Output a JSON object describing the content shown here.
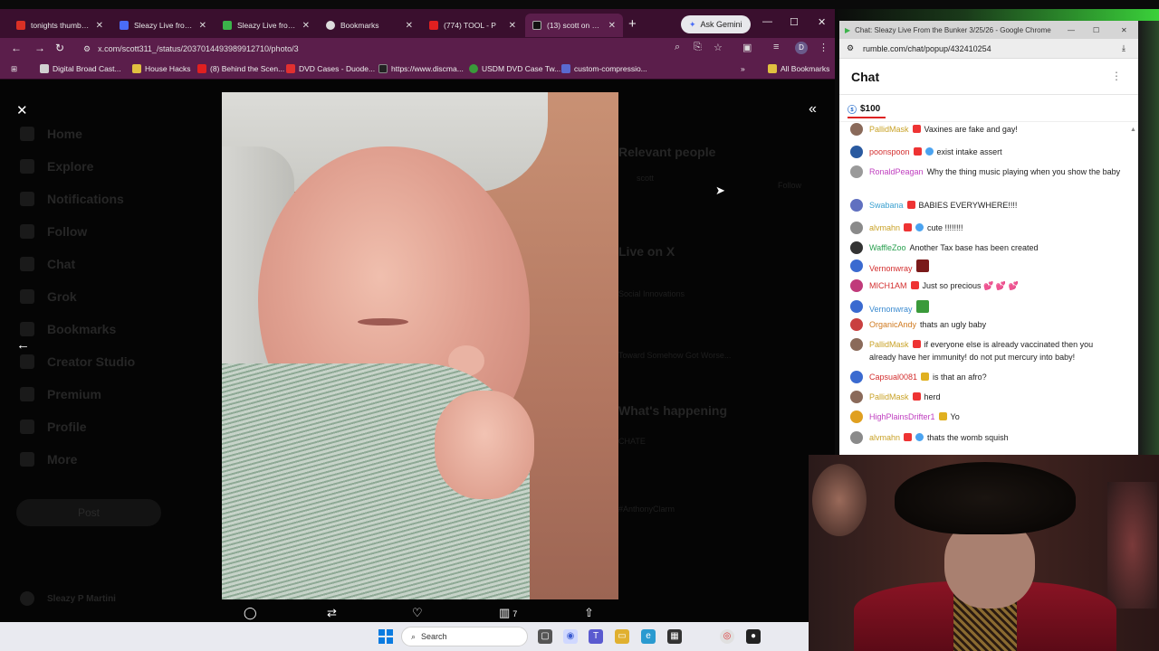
{
  "browser": {
    "tabs": [
      {
        "label": "tonights thumbs - |",
        "color": "#d93025"
      },
      {
        "label": "Sleazy Live from th",
        "color": "#4a6cf7"
      },
      {
        "label": "Sleazy Live from th",
        "color": "#3bb34a"
      },
      {
        "label": "Bookmarks",
        "color": "#dddddd"
      },
      {
        "label": "(774) TOOL - P",
        "color": "#e02020"
      },
      {
        "label": "(13) scott on X: \"h",
        "color": "#111111"
      }
    ],
    "ask_gemini": "Ask Gemini",
    "url": "x.com/scott311_/status/2037014493989912710/photo/3",
    "profile_initial": "D",
    "bookmarks": [
      "Digital Broad Cast...",
      "House Hacks",
      "(8) Behind the Scen...",
      "DVD Cases - Duode...",
      "https://www.discma...",
      "USDM DVD Case Tw...",
      "custom-compressio..."
    ],
    "all_bookmarks": "All Bookmarks",
    "more_bookmarks": "»"
  },
  "xpage": {
    "nav_items": [
      "Home",
      "Explore",
      "Notifications",
      "Follow",
      "Chat",
      "Grok",
      "Bookmarks",
      "Creator Studio",
      "Premium",
      "Profile",
      "More"
    ],
    "post_button": "Post",
    "right_headings": [
      "Relevant people",
      "Live on X",
      "What's happening"
    ],
    "right_texts": [
      "scott",
      "Follow",
      "Social Innovations",
      "Toward Somehow Got Worse...",
      "CHATE",
      "#AnthonyClarm"
    ],
    "bottom_user": "Sleazy P Martini",
    "actions": {
      "views": "7"
    }
  },
  "icons": {
    "close": "✕",
    "back": "←",
    "collapse": "«",
    "reply": "💬",
    "repost": "⇄",
    "like": "♡",
    "views": "📊",
    "share": "⇧"
  },
  "taskbar": {
    "search_label": "Search"
  },
  "chat_window": {
    "title_bar": "Chat: Sleazy Live From the Bunker 3/25/26 - Google Chrome",
    "url": "rumble.com/chat/popup/432410254",
    "heading": "Chat",
    "rant_amount": "$100",
    "messages": [
      {
        "user": "PallidMask",
        "text": "Vaxines are fake and gay!",
        "color": "#c9a227",
        "avatar": "#8a6a5a",
        "badge": "#e33"
      },
      {
        "user": "poonspoon",
        "text": "exist intake assert",
        "color": "#d32f2f",
        "avatar": "#2a5aa0",
        "badge": "#e33",
        "badge2": "#4aa3f0"
      },
      {
        "user": "RonaldPeagan",
        "text": "Why the thing music playing when you show the baby",
        "color": "#c040c0",
        "avatar": "#9a9a9a"
      },
      {
        "user": "Swabana",
        "text": "BABIES EVERYWHERE!!!!",
        "color": "#3aa0d0",
        "avatar": "#6070c0",
        "badge": "#e33"
      },
      {
        "user": "alvmahn",
        "text": "cute !!!!!!!!",
        "color": "#c9a227",
        "avatar": "#8a8a8a",
        "badge": "#e33",
        "badge2": "#4aa3f0"
      },
      {
        "user": "WaffleZoo",
        "text": "Another Tax base has been created",
        "color": "#2aa050",
        "avatar": "#333333"
      },
      {
        "user": "Vernonwray",
        "text": "",
        "color": "#d32f2f",
        "avatar": "#3a6ad0"
      },
      {
        "user": "MICH1AM",
        "text": "Just so precious 💕 💕 💕",
        "color": "#d32f2f",
        "avatar": "#c03a7a",
        "badge": "#e33"
      },
      {
        "user": "Vernonwray",
        "text": "",
        "color": "#3a8ad0",
        "avatar": "#3a6ad0"
      },
      {
        "user": "OrganicAndy",
        "text": "thats an ugly baby",
        "color": "#d07a20",
        "avatar": "#c94040"
      },
      {
        "user": "PallidMask",
        "text": "if everyone else is already vaccinated then you already have her immunity! do not put mercury into baby!",
        "color": "#c9a227",
        "avatar": "#8a6a5a",
        "badge": "#e33"
      },
      {
        "user": "Capsual0081",
        "text": "is that an afro?",
        "color": "#d32f2f",
        "avatar": "#3a6ad0",
        "badge": "#e0b020"
      },
      {
        "user": "PallidMask",
        "text": "herd",
        "color": "#c9a227",
        "avatar": "#8a6a5a",
        "badge": "#e33"
      },
      {
        "user": "HighPlainsDrifter1",
        "text": "Yo",
        "color": "#c040c0",
        "avatar": "#e0a020",
        "badge": "#e0b020"
      },
      {
        "user": "alvmahn",
        "text": "thats the womb squish",
        "color": "#c9a227",
        "avatar": "#8a8a8a",
        "badge": "#e33",
        "badge2": "#4aa3f0"
      }
    ]
  }
}
